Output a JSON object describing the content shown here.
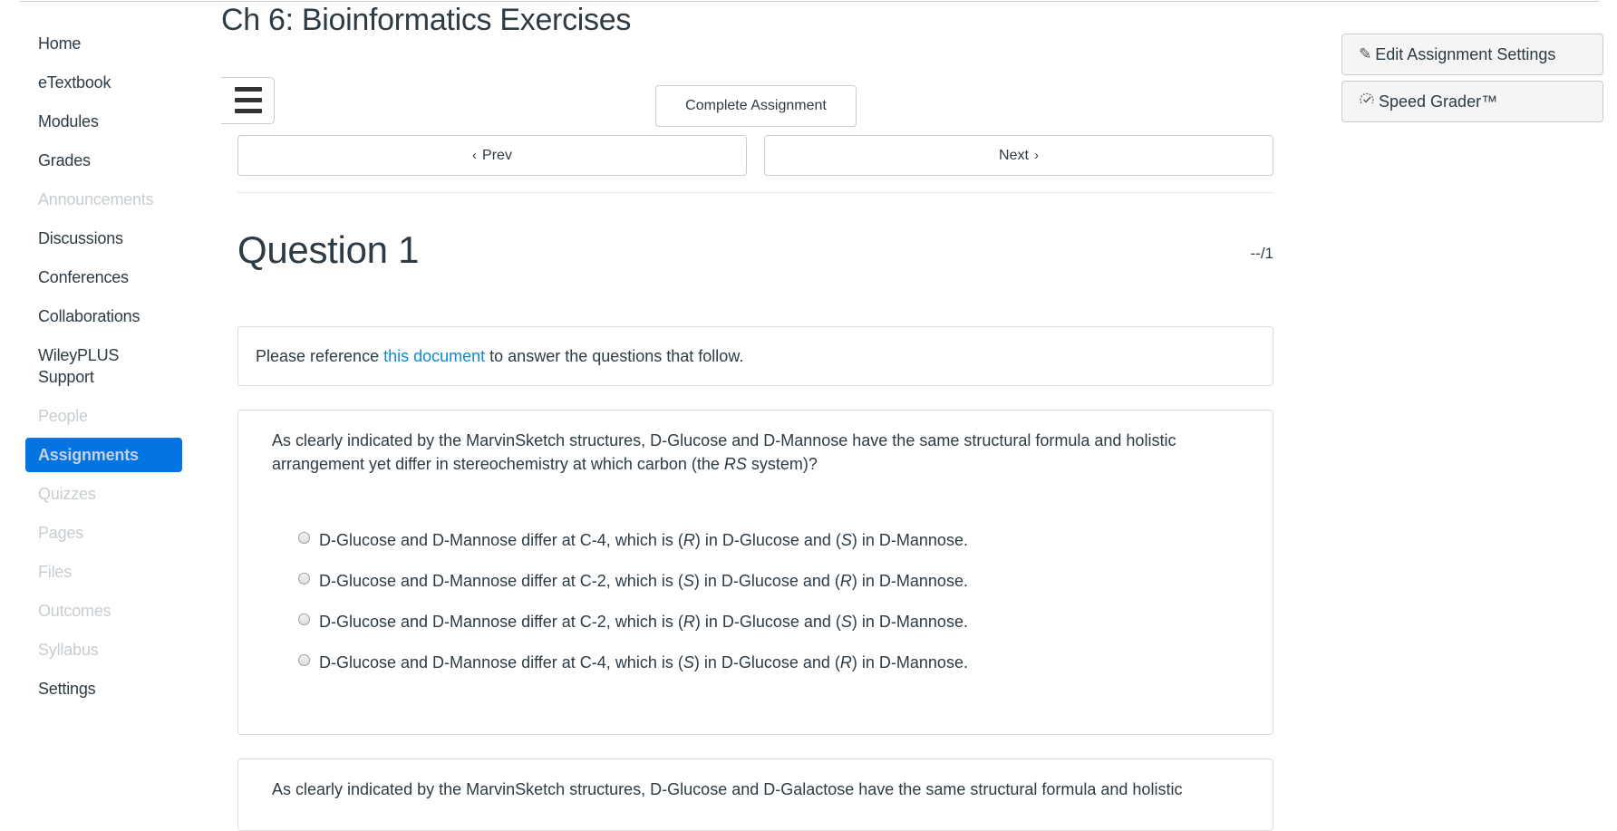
{
  "page": {
    "title": "Ch 6: Bioinformatics Exercises"
  },
  "sidebar": {
    "items": [
      {
        "label": "Home",
        "state": "enabled"
      },
      {
        "label": "eTextbook",
        "state": "enabled"
      },
      {
        "label": "Modules",
        "state": "enabled"
      },
      {
        "label": "Grades",
        "state": "enabled"
      },
      {
        "label": "Announcements",
        "state": "disabled"
      },
      {
        "label": "Discussions",
        "state": "enabled"
      },
      {
        "label": "Conferences",
        "state": "enabled"
      },
      {
        "label": "Collaborations",
        "state": "enabled"
      },
      {
        "label": "WileyPLUS Support",
        "state": "enabled"
      },
      {
        "label": "People",
        "state": "disabled"
      },
      {
        "label": "Assignments",
        "state": "active"
      },
      {
        "label": "Quizzes",
        "state": "disabled"
      },
      {
        "label": "Pages",
        "state": "disabled"
      },
      {
        "label": "Files",
        "state": "disabled"
      },
      {
        "label": "Outcomes",
        "state": "disabled"
      },
      {
        "label": "Syllabus",
        "state": "disabled"
      },
      {
        "label": "Settings",
        "state": "enabled"
      }
    ],
    "active_color": "#0374e2"
  },
  "toolbar": {
    "complete_label": "Complete Assignment",
    "prev_label": "Prev",
    "next_label": "Next"
  },
  "right_actions": {
    "edit_label": "Edit Assignment Settings",
    "speed_grader_label": "Speed Grader™"
  },
  "question": {
    "title": "Question 1",
    "points": "--/1",
    "reference": {
      "before": "Please reference ",
      "link": "this document",
      "after": " to answer the questions that follow."
    },
    "prompt_before": "As clearly indicated by the MarvinSketch structures, D-Glucose and D-Mannose have the same structural formula and holistic arrangement yet differ in stereochemistry at which carbon (the ",
    "prompt_italic": "RS",
    "prompt_after": " system)?",
    "answers": [
      {
        "prefix": "D-Glucose and D-Mannose differ at C-4, which is (",
        "c1": "R",
        "mid": ") in D-Glucose and (",
        "c2": "S",
        "suffix": ") in D-Mannose.",
        "selected": false
      },
      {
        "prefix": "D-Glucose and D-Mannose differ at C-2, which is (",
        "c1": "S",
        "mid": ") in D-Glucose and (",
        "c2": "R",
        "suffix": ") in D-Mannose.",
        "selected": false
      },
      {
        "prefix": "D-Glucose and D-Mannose differ at C-2, which is (",
        "c1": "R",
        "mid": ") in D-Glucose and (",
        "c2": "S",
        "suffix": ") in D-Mannose.",
        "selected": false
      },
      {
        "prefix": "D-Glucose and D-Mannose differ at C-4, which is (",
        "c1": "S",
        "mid": ") in D-Glucose and (",
        "c2": "R",
        "suffix": ") in D-Mannose.",
        "selected": false
      }
    ]
  },
  "next_question": {
    "prompt_partial": "As clearly indicated by the MarvinSketch structures, D-Glucose and D-Galactose have the same structural formula and holistic"
  },
  "colors": {
    "link": "#0b8ad6",
    "text": "#2d3b45",
    "disabled": "#c7cdd1"
  }
}
